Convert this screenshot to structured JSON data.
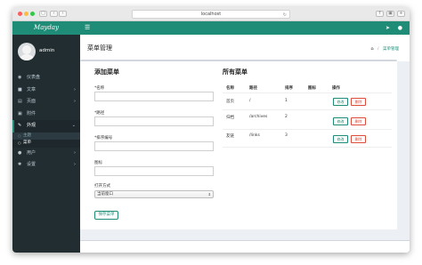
{
  "browser": {
    "url": "localhost"
  },
  "brand": {
    "logo": "Mayday",
    "accent": "#1f8c77",
    "sidebar_bg": "#222d32"
  },
  "user": {
    "name": "admin"
  },
  "sidebar": {
    "items": [
      {
        "label": "仪表盘",
        "icon": "dashboard-icon"
      },
      {
        "label": "文章",
        "icon": "article-icon"
      },
      {
        "label": "页面",
        "icon": "page-icon"
      },
      {
        "label": "附件",
        "icon": "attachment-icon"
      },
      {
        "label": "外观",
        "icon": "appearance-icon"
      },
      {
        "label": "用户",
        "icon": "user-icon"
      },
      {
        "label": "设置",
        "icon": "settings-icon"
      }
    ],
    "sub_items": [
      {
        "label": "主题"
      },
      {
        "label": "菜单"
      }
    ]
  },
  "page": {
    "title": "菜单管理",
    "breadcrumb_current": "菜单管理",
    "breadcrumb_sep": "/"
  },
  "form": {
    "heading": "添加菜单",
    "name_label": "*名称",
    "path_label": "*路径",
    "sort_label": "*排序编号",
    "icon_label": "图标",
    "target_label": "打开方式",
    "target_value": "当前窗口",
    "save_label": "保存菜单"
  },
  "table": {
    "heading": "所有菜单",
    "columns": [
      "名称",
      "路径",
      "排序",
      "图标",
      "操作"
    ],
    "rows": [
      {
        "name": "首页",
        "path": "/",
        "sort": "1",
        "icon": ""
      },
      {
        "name": "归档",
        "path": "/archives",
        "sort": "2",
        "icon": ""
      },
      {
        "name": "友链",
        "path": "/links",
        "sort": "3",
        "icon": ""
      }
    ],
    "edit_label": "修改",
    "delete_label": "删除"
  }
}
